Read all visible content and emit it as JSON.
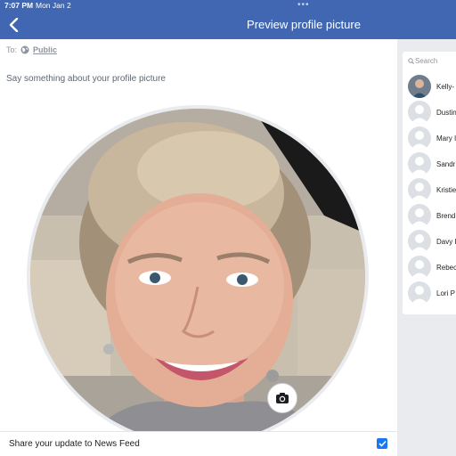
{
  "status_bar": {
    "time": "7:07 PM",
    "date": "Mon Jan 2",
    "multitask": "•••"
  },
  "nav": {
    "title": "Preview profile picture",
    "back_icon": "chevron-left-icon"
  },
  "composer": {
    "audience_prefix": "To:",
    "audience_icon": "globe-icon",
    "audience_value": "Public",
    "caption_placeholder": "Say something about your profile picture"
  },
  "photo": {
    "camera_icon": "camera-icon"
  },
  "share": {
    "label": "Share your update to News Feed",
    "checked": true
  },
  "sidebar": {
    "search_placeholder": "Search",
    "contacts": [
      {
        "name": "Kelly-",
        "has_photo": true
      },
      {
        "name": "Dustin",
        "has_photo": false
      },
      {
        "name": "Mary I",
        "has_photo": false
      },
      {
        "name": "Sandr",
        "has_photo": false
      },
      {
        "name": "Kristie",
        "has_photo": false
      },
      {
        "name": "Brend",
        "has_photo": false
      },
      {
        "name": "Davy I",
        "has_photo": false
      },
      {
        "name": "Rebec",
        "has_photo": false
      },
      {
        "name": "Lori P",
        "has_photo": false
      }
    ]
  },
  "colors": {
    "brand_blue": "#4267b2",
    "check_blue": "#1877f2",
    "sidebar_bg": "#e9ebee"
  }
}
